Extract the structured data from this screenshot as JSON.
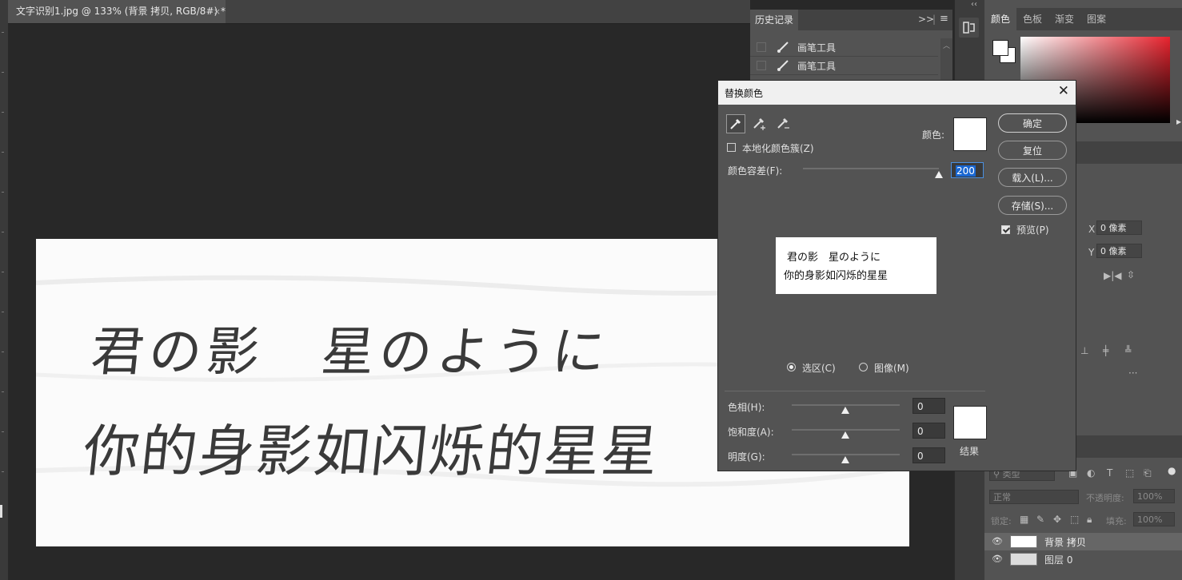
{
  "document_tab": {
    "title": "文字识别1.jpg @ 133% (背景 拷贝, RGB/8#) *",
    "close": "×"
  },
  "history": {
    "tab": "历史记录",
    "expand": ">>",
    "menu": "≡",
    "items": [
      {
        "label": "画笔工具"
      },
      {
        "label": "画笔工具"
      }
    ]
  },
  "document": {
    "line1": "君の影　星のように",
    "line2": "你的身影如闪烁的星星"
  },
  "color_panel": {
    "tabs": [
      "颜色",
      "色板",
      "渐变",
      "图案"
    ],
    "foreground": "#ffffff",
    "background": "#ffffff",
    "hue_color": "#e8232e"
  },
  "properties": {
    "x_label": "X",
    "x_value": "0 像素",
    "y_label": "Y",
    "y_value": "0 像素"
  },
  "layers": {
    "filter_placeholder": "类型",
    "blend_mode": "正常",
    "opacity_label": "不透明度:",
    "opacity_value": "100%",
    "lock_label": "锁定:",
    "fill_label": "填充:",
    "fill_value": "100%",
    "items": [
      {
        "name": "背景 拷贝",
        "selected": true
      },
      {
        "name": "图层 0",
        "selected": false
      }
    ]
  },
  "dialog": {
    "title": "替换颜色",
    "close": "✕",
    "localized_clusters_label": "本地化颜色簇(Z)",
    "localized_clusters_checked": false,
    "color_label": "颜色:",
    "tolerance_label": "颜色容差(F):",
    "tolerance_value": "200",
    "tolerance_fraction": 1.0,
    "preview_lines": [
      "君の影　星のように",
      "你的身影如闪烁的星星"
    ],
    "selection_label": "选区(C)",
    "image_label": "图像(M)",
    "selected_mode": "selection",
    "buttons": {
      "ok": "确定",
      "reset": "复位",
      "load": "载入(L)...",
      "save": "存储(S)..."
    },
    "preview_label": "预览(P)",
    "preview_checked": true,
    "hue_label": "色相(H):",
    "hue_value": "0",
    "saturation_label": "饱和度(A):",
    "saturation_value": "0",
    "lightness_label": "明度(G):",
    "lightness_value": "0",
    "result_label": "结果"
  }
}
